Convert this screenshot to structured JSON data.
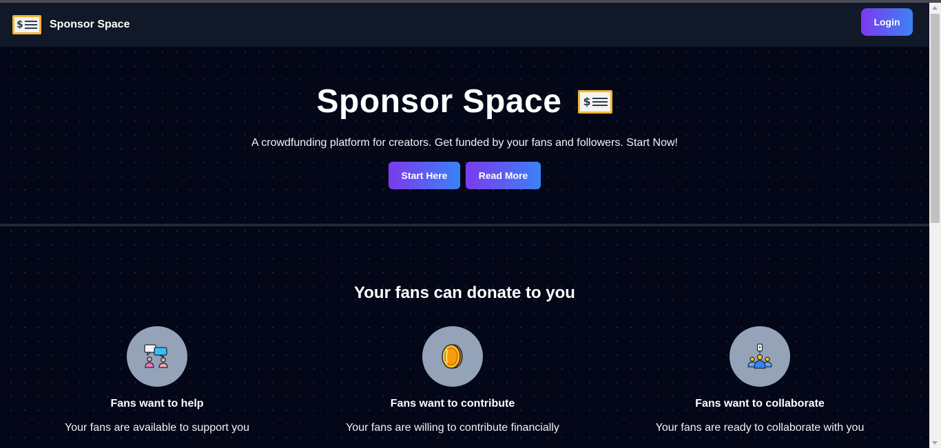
{
  "navbar": {
    "brand_name": "Sponsor Space",
    "brand_icon": "check-money-icon",
    "login_label": "Login"
  },
  "hero": {
    "title": "Sponsor Space",
    "title_icon": "check-money-icon",
    "subtitle": "A crowdfunding platform for creators. Get funded by your fans and followers. Start Now!",
    "start_label": "Start Here",
    "read_more_label": "Read More"
  },
  "section": {
    "title": "Your fans can donate to you",
    "features": [
      {
        "icon": "chat-people-icon",
        "title": "Fans want to help",
        "description": "Your fans are available to support you"
      },
      {
        "icon": "coin-icon",
        "title": "Fans want to contribute",
        "description": "Your fans are willing to contribute financially"
      },
      {
        "icon": "group-collaborate-icon",
        "title": "Fans want to collaborate",
        "description": "Your fans are ready to collaborate with you"
      }
    ]
  },
  "colors": {
    "background": "#030718",
    "navbar": "#111827",
    "button_gradient_start": "#7c3aed",
    "button_gradient_end": "#3b82f6",
    "icon_circle": "#94a3b8"
  }
}
